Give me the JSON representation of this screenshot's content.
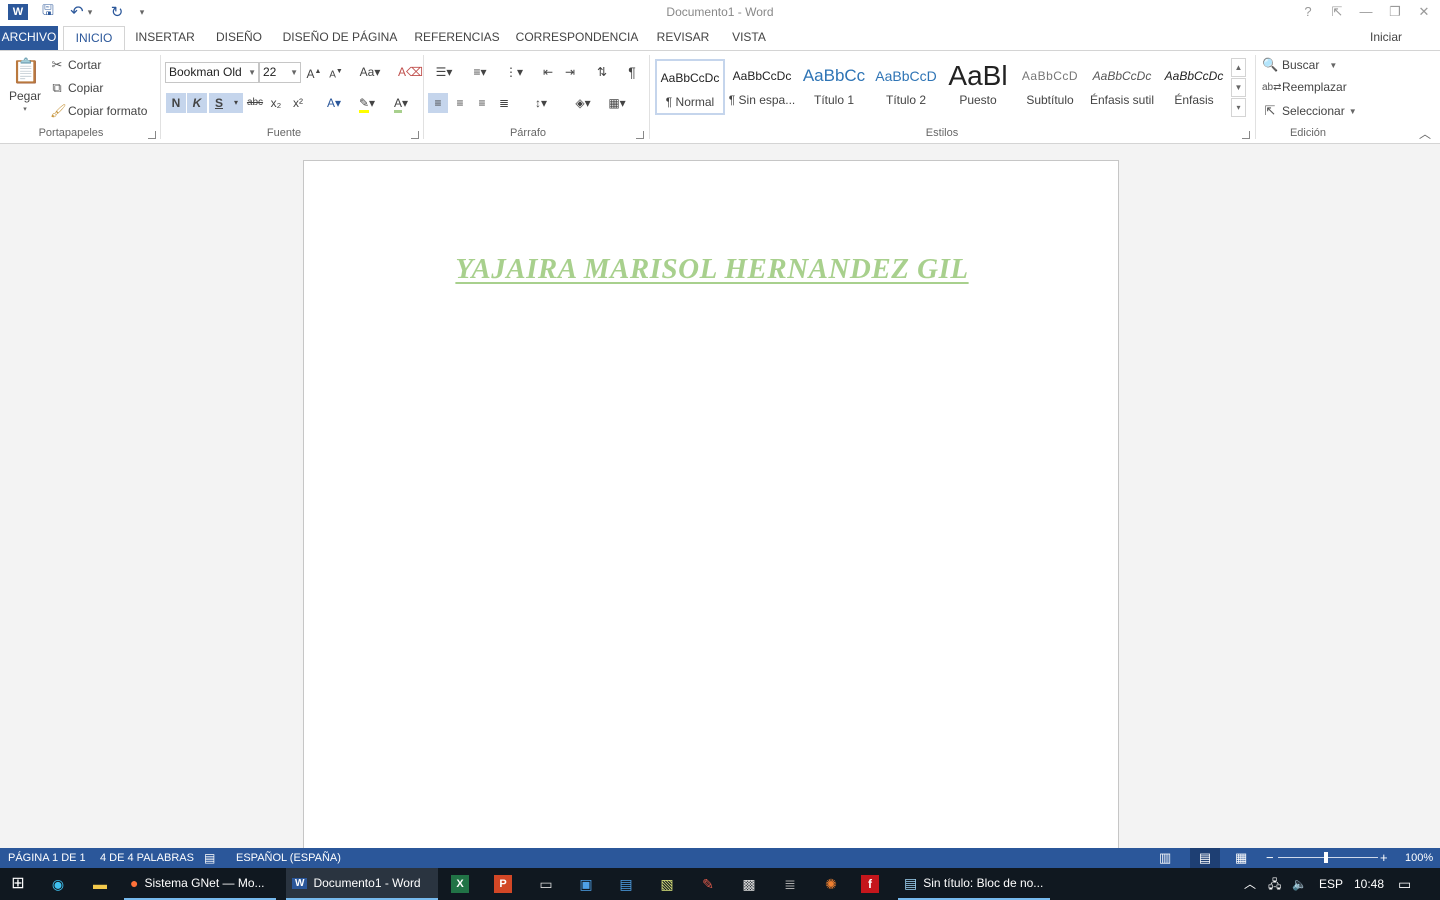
{
  "window": {
    "title": "Documento1 - Word",
    "help": "?",
    "ribbon_display": "⇱",
    "minimize": "—",
    "restore": "❐",
    "close": "✕"
  },
  "qat": {
    "word_logo": "W",
    "save": "🖫",
    "undo": "↶",
    "undo_dd": "▾",
    "redo": "↻",
    "customize": "▾"
  },
  "tabs": [
    {
      "label": "ARCHIVO"
    },
    {
      "label": "INICIO"
    },
    {
      "label": "INSERTAR"
    },
    {
      "label": "DISEÑO"
    },
    {
      "label": "DISEÑO DE PÁGINA"
    },
    {
      "label": "REFERENCIAS"
    },
    {
      "label": "CORRESPONDENCIA"
    },
    {
      "label": "REVISAR"
    },
    {
      "label": "VISTA"
    }
  ],
  "signin": "Iniciar sesión",
  "clipboard": {
    "label": "Portapapeles",
    "paste": "Pegar",
    "cut": "Cortar",
    "copy": "Copiar",
    "format_painter": "Copiar formato"
  },
  "font": {
    "label": "Fuente",
    "family": "Bookman Old",
    "size": "22",
    "bold": "N",
    "italic": "K",
    "underline": "S",
    "strike": "abc",
    "subscript": "x₂",
    "superscript": "x²"
  },
  "paragraph": {
    "label": "Párrafo",
    "pilcrow": "¶"
  },
  "styles": {
    "label": "Estilos",
    "items": [
      {
        "sample": "AaBbCcDc",
        "name": "¶ Normal"
      },
      {
        "sample": "AaBbCcDc",
        "name": "¶ Sin espa..."
      },
      {
        "sample": "AaBbCc",
        "name": "Título 1"
      },
      {
        "sample": "AaBbCcD",
        "name": "Título 2"
      },
      {
        "sample": "AaBl",
        "name": "Puesto"
      },
      {
        "sample": "AaBbCcD",
        "name": "Subtítulo"
      },
      {
        "sample": "AaBbCcDc",
        "name": "Énfasis sutil"
      },
      {
        "sample": "AaBbCcDc",
        "name": "Énfasis"
      }
    ]
  },
  "editing": {
    "label": "Edición",
    "find": "Buscar",
    "replace": "Reemplazar",
    "select": "Seleccionar"
  },
  "document": {
    "heading": "YAJAIRA MARISOL HERNANDEZ GIL",
    "heading_color": "#a8d08d"
  },
  "status": {
    "page": "PÁGINA 1 DE 1",
    "words": "4 DE 4 PALABRAS",
    "language": "ESPAÑOL (ESPAÑA)",
    "zoom": "100%",
    "zoom_minus": "−",
    "zoom_plus": "+"
  },
  "taskbar": {
    "apps": [
      {
        "label": "Sistema GNet — Mo..."
      },
      {
        "label": "Documento1 - Word"
      },
      {
        "label": "Sin título: Bloc de no..."
      }
    ],
    "lang": "ESP",
    "time": "10:48"
  },
  "colors": {
    "accent": "#2b579a",
    "taskbar": "#101820"
  }
}
